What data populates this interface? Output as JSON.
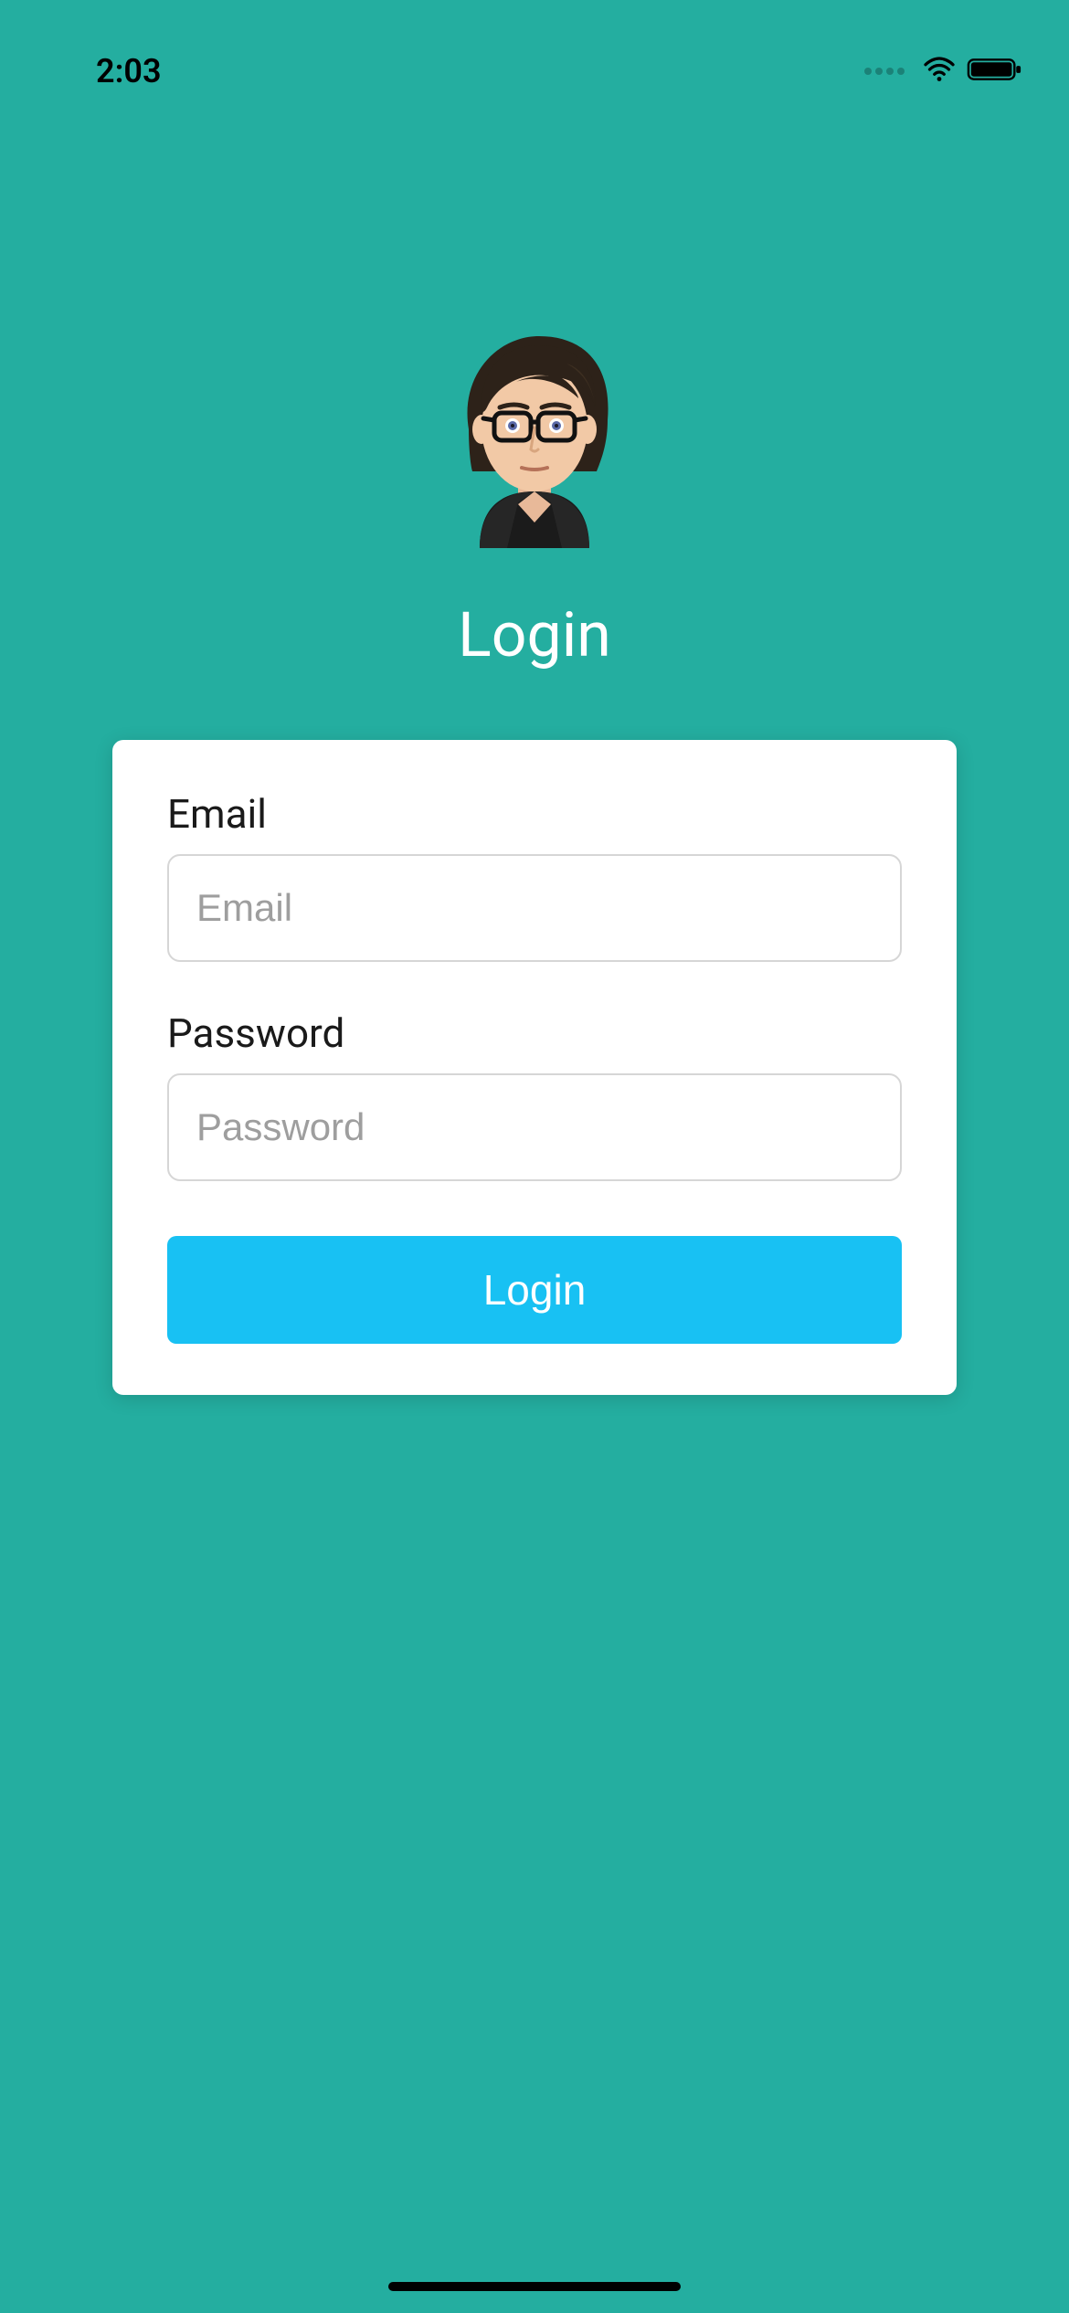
{
  "status": {
    "time": "2:03"
  },
  "page": {
    "title": "Login"
  },
  "form": {
    "email": {
      "label": "Email",
      "placeholder": "Email",
      "value": ""
    },
    "password": {
      "label": "Password",
      "placeholder": "Password",
      "value": ""
    },
    "submit_label": "Login"
  },
  "colors": {
    "background": "#24aea0",
    "button": "#18c1f3"
  }
}
